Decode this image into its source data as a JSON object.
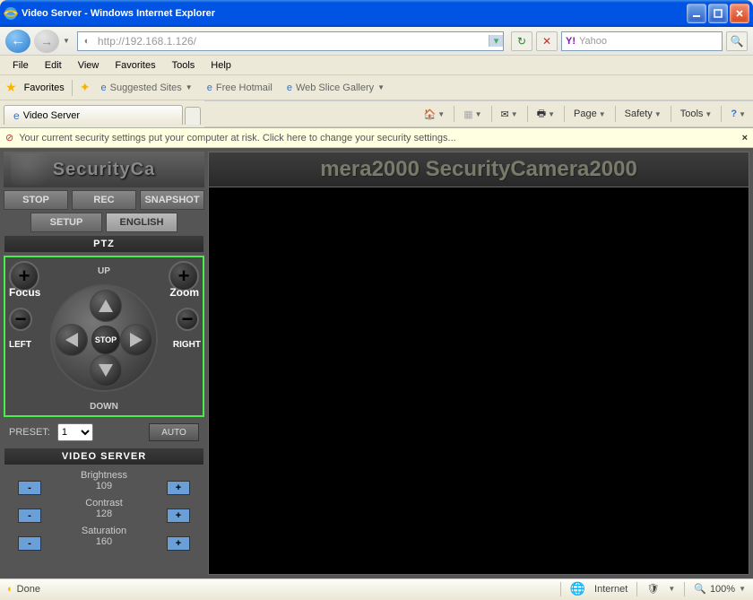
{
  "window": {
    "title": "Video Server - Windows Internet Explorer"
  },
  "nav": {
    "url": "http://192.168.1.126/",
    "search_placeholder": "Yahoo"
  },
  "menu": {
    "file": "File",
    "edit": "Edit",
    "view": "View",
    "favorites": "Favorites",
    "tools": "Tools",
    "help": "Help"
  },
  "favbar": {
    "favorites": "Favorites",
    "suggested": "Suggested Sites",
    "hotmail": "Free Hotmail",
    "webslice": "Web Slice Gallery"
  },
  "tab": {
    "title": "Video Server"
  },
  "cmd": {
    "page": "Page",
    "safety": "Safety",
    "tools": "Tools"
  },
  "secwarn": {
    "text": "Your current security settings put your computer at risk. Click here to change your security settings..."
  },
  "sidebar": {
    "banner": "SecurityCa",
    "row1": {
      "stop": "STOP",
      "rec": "REC",
      "snapshot": "SNAPSHOT"
    },
    "row2": {
      "setup": "SETUP",
      "english": "ENGLISH"
    },
    "ptz_hdr": "PTZ",
    "ptz": {
      "focus": "Focus",
      "zoom": "Zoom",
      "left": "LEFT",
      "right": "RIGHT",
      "up": "UP",
      "down": "DOWN",
      "stop": "STOP"
    },
    "preset": {
      "label": "PRESET:",
      "value": "1",
      "auto": "AUTO"
    },
    "vs_hdr": "VIDEO SERVER",
    "brightness": {
      "label": "Brightness",
      "value": "109"
    },
    "contrast": {
      "label": "Contrast",
      "value": "128"
    },
    "saturation": {
      "label": "Saturation",
      "value": "160"
    }
  },
  "video": {
    "banner": "mera2000 SecurityCamera2000"
  },
  "status": {
    "done": "Done",
    "zone": "Internet",
    "zoom": "100%"
  }
}
